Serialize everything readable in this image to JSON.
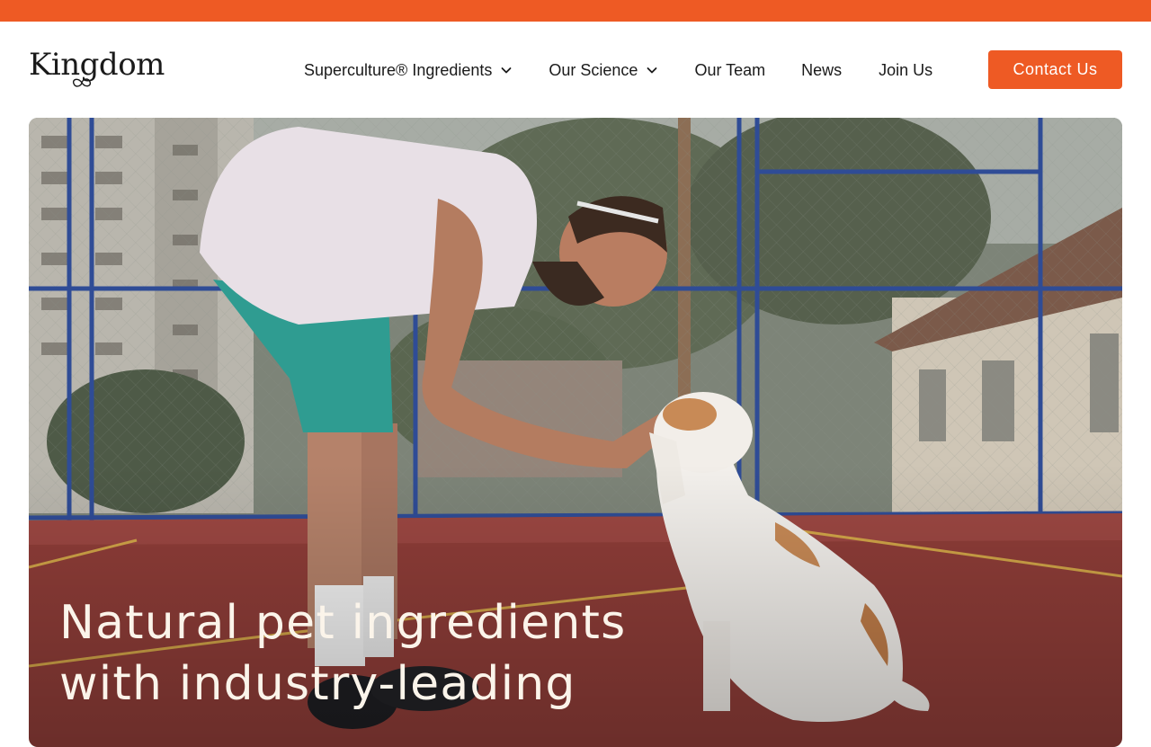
{
  "brand": {
    "name": "Kingdom",
    "accent": "#EE5A24"
  },
  "nav": {
    "items": [
      {
        "label": "Superculture® Ingredients",
        "dropdown": true
      },
      {
        "label": "Our Science",
        "dropdown": true
      },
      {
        "label": "Our Team",
        "dropdown": false
      },
      {
        "label": "News",
        "dropdown": false
      },
      {
        "label": "Join Us",
        "dropdown": false
      }
    ],
    "cta_label": "Contact Us"
  },
  "hero": {
    "title": "Natural pet ingredients with industry-leading",
    "image": "man-touching-bulldog-on-basketball-court-photo"
  }
}
